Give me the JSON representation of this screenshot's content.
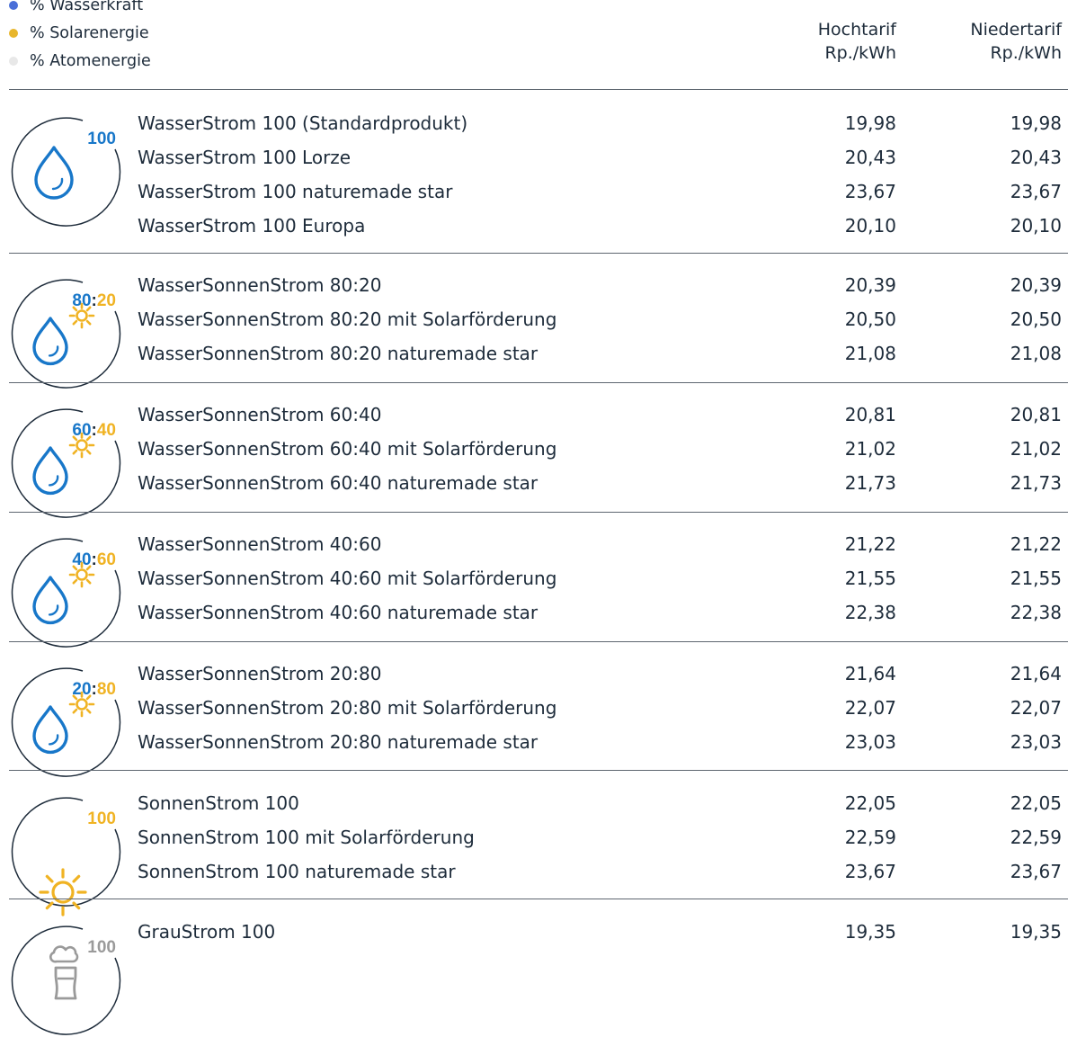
{
  "legend": [
    {
      "label": "% Wasserkraft",
      "color": "#4a6fd8"
    },
    {
      "label": "% Solarenergie",
      "color": "#e8b62c"
    },
    {
      "label": "% Atomenergie",
      "color": "#e8e8e8"
    }
  ],
  "columns": {
    "hoch": {
      "line1": "Hochtarif",
      "line2": "Rp./kWh"
    },
    "nieder": {
      "line1": "Niedertarif",
      "line2": "Rp./kWh"
    }
  },
  "colors": {
    "water": "#1877c9",
    "sun": "#f0b323",
    "grey": "#9a9a9a",
    "circle": "#1d2b3a"
  },
  "groups": [
    {
      "icon": "water-drop-icon",
      "badge": [
        {
          "text": "100",
          "tone": "water"
        }
      ],
      "rows": [
        {
          "name": "WasserStrom 100 (Standardprodukt)",
          "ht": "19,98",
          "nt": "19,98"
        },
        {
          "name": "WasserStrom 100 Lorze",
          "ht": "20,43",
          "nt": "20,43"
        },
        {
          "name": "WasserStrom 100 naturemade star",
          "ht": "23,67",
          "nt": "23,67"
        },
        {
          "name": "WasserStrom 100 Europa",
          "ht": "20,10",
          "nt": "20,10"
        }
      ]
    },
    {
      "icon": "water-sun-icon",
      "badge": [
        {
          "text": "80",
          "tone": "water"
        },
        {
          "text": ":",
          "tone": "circle"
        },
        {
          "text": "20",
          "tone": "sun"
        }
      ],
      "rows": [
        {
          "name": "WasserSonnenStrom 80:20",
          "ht": "20,39",
          "nt": "20,39"
        },
        {
          "name": "WasserSonnenStrom 80:20 mit Solarförderung",
          "ht": "20,50",
          "nt": "20,50"
        },
        {
          "name": "WasserSonnenStrom 80:20 naturemade star",
          "ht": "21,08",
          "nt": "21,08"
        }
      ]
    },
    {
      "icon": "water-sun-icon",
      "badge": [
        {
          "text": "60",
          "tone": "water"
        },
        {
          "text": ":",
          "tone": "circle"
        },
        {
          "text": "40",
          "tone": "sun"
        }
      ],
      "rows": [
        {
          "name": "WasserSonnenStrom 60:40",
          "ht": "20,81",
          "nt": "20,81"
        },
        {
          "name": "WasserSonnenStrom 60:40 mit Solarförderung",
          "ht": "21,02",
          "nt": "21,02"
        },
        {
          "name": "WasserSonnenStrom 60:40 naturemade star",
          "ht": "21,73",
          "nt": "21,73"
        }
      ]
    },
    {
      "icon": "water-sun-icon",
      "badge": [
        {
          "text": "40",
          "tone": "water"
        },
        {
          "text": ":",
          "tone": "circle"
        },
        {
          "text": "60",
          "tone": "sun"
        }
      ],
      "rows": [
        {
          "name": "WasserSonnenStrom 40:60",
          "ht": "21,22",
          "nt": "21,22"
        },
        {
          "name": "WasserSonnenStrom 40:60 mit Solarförderung",
          "ht": "21,55",
          "nt": "21,55"
        },
        {
          "name": "WasserSonnenStrom 40:60 naturemade star",
          "ht": "22,38",
          "nt": "22,38"
        }
      ]
    },
    {
      "icon": "water-sun-icon",
      "badge": [
        {
          "text": "20",
          "tone": "water"
        },
        {
          "text": ":",
          "tone": "circle"
        },
        {
          "text": "80",
          "tone": "sun"
        }
      ],
      "rows": [
        {
          "name": "WasserSonnenStrom 20:80",
          "ht": "21,64",
          "nt": "21,64"
        },
        {
          "name": "WasserSonnenStrom 20:80 mit Solarförderung",
          "ht": "22,07",
          "nt": "22,07"
        },
        {
          "name": "WasserSonnenStrom 20:80 naturemade star",
          "ht": "23,03",
          "nt": "23,03"
        }
      ]
    },
    {
      "icon": "sun-icon",
      "badge": [
        {
          "text": "100",
          "tone": "sun"
        }
      ],
      "rows": [
        {
          "name": "SonnenStrom 100",
          "ht": "22,05",
          "nt": "22,05"
        },
        {
          "name": "SonnenStrom 100 mit Solarförderung",
          "ht": "22,59",
          "nt": "22,59"
        },
        {
          "name": "SonnenStrom 100 naturemade star",
          "ht": "23,67",
          "nt": "23,67"
        }
      ]
    },
    {
      "icon": "nuclear-plant-icon",
      "badge": [
        {
          "text": "100",
          "tone": "grey"
        }
      ],
      "rows": [
        {
          "name": "GrauStrom 100",
          "ht": "19,35",
          "nt": "19,35"
        }
      ]
    }
  ]
}
